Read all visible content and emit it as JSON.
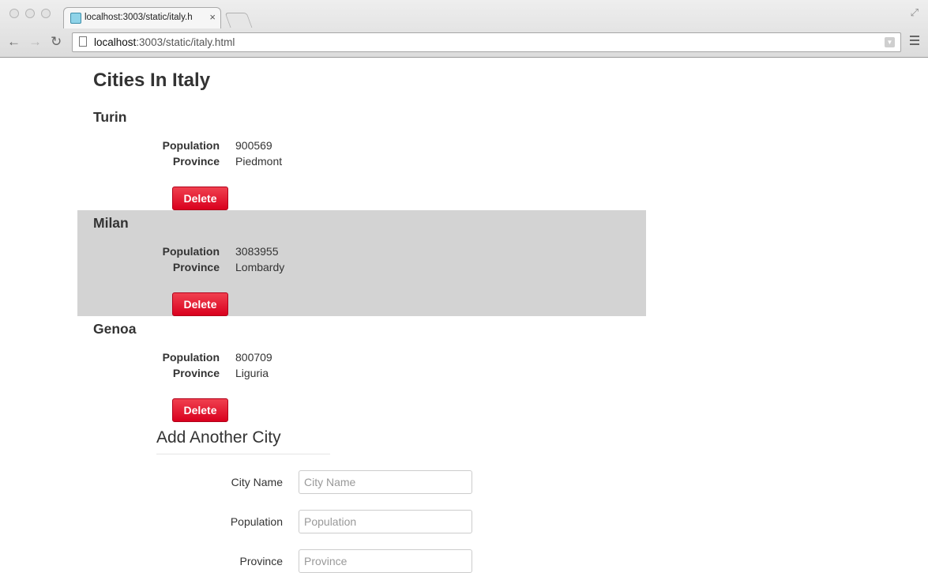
{
  "browser": {
    "tab_title": "localhost:3003/static/italy.h",
    "tab_close": "×",
    "url_host": "localhost",
    "url_rest": ":3003/static/italy.html",
    "back_glyph": "←",
    "forward_glyph": "→",
    "reload_glyph": "↻"
  },
  "page": {
    "title": "Cities In Italy",
    "population_label": "Population",
    "province_label": "Province",
    "delete_label": "Delete"
  },
  "cities": [
    {
      "name": "Turin",
      "population": "900569",
      "province": "Piedmont",
      "highlighted": false
    },
    {
      "name": "Milan",
      "population": "3083955",
      "province": "Lombardy",
      "highlighted": true
    },
    {
      "name": "Genoa",
      "population": "800709",
      "province": "Liguria",
      "highlighted": false
    }
  ],
  "form": {
    "heading": "Add Another City",
    "fields": [
      {
        "label": "City Name",
        "placeholder": "City Name"
      },
      {
        "label": "Population",
        "placeholder": "Population"
      },
      {
        "label": "Province",
        "placeholder": "Province"
      }
    ]
  },
  "colors": {
    "delete_button": "#e3142d",
    "highlight_row": "#d3d3d3"
  }
}
